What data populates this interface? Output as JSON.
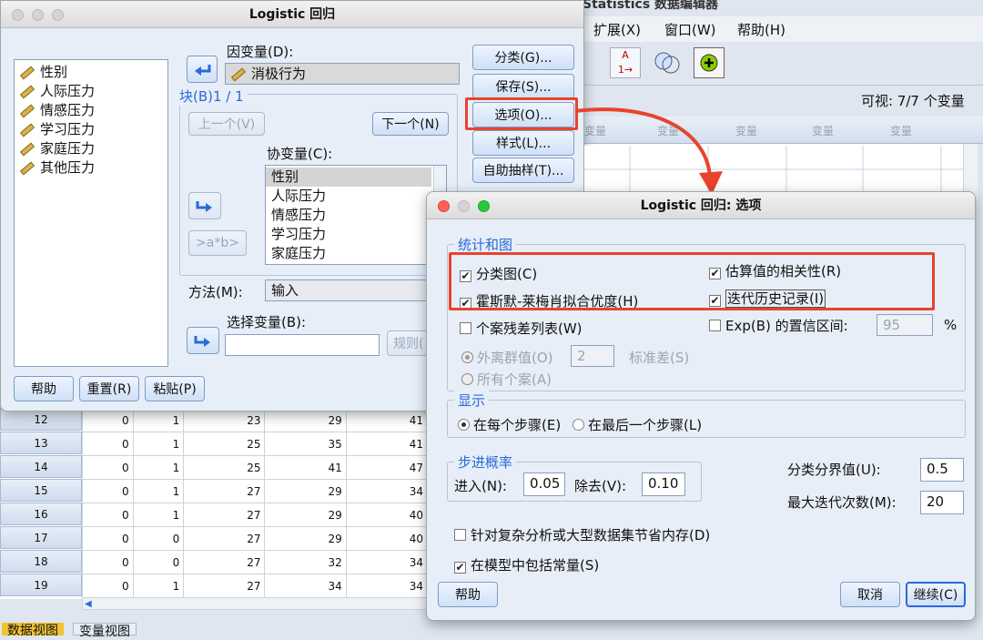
{
  "bg": {
    "title": "Statistics 数据编辑器",
    "menu": [
      "扩展(X)",
      "窗口(W)",
      "帮助(H)"
    ],
    "visible": "可视: 7/7 个变量",
    "col_header": "变量",
    "rows": [
      {
        "n": "12",
        "c": [
          "0",
          "1",
          "23",
          "29",
          "41"
        ]
      },
      {
        "n": "13",
        "c": [
          "0",
          "1",
          "25",
          "35",
          "41"
        ]
      },
      {
        "n": "14",
        "c": [
          "0",
          "1",
          "25",
          "41",
          "47"
        ]
      },
      {
        "n": "15",
        "c": [
          "0",
          "1",
          "27",
          "29",
          "34"
        ]
      },
      {
        "n": "16",
        "c": [
          "0",
          "1",
          "27",
          "29",
          "40"
        ]
      },
      {
        "n": "17",
        "c": [
          "0",
          "0",
          "27",
          "29",
          "40"
        ]
      },
      {
        "n": "18",
        "c": [
          "0",
          "0",
          "27",
          "32",
          "34"
        ]
      },
      {
        "n": "19",
        "c": [
          "0",
          "1",
          "27",
          "34",
          "34"
        ]
      }
    ],
    "tabs": [
      "数据视图",
      "变量视图"
    ]
  },
  "logistic": {
    "title": "Logistic 回归",
    "variables": [
      "性别",
      "人际压力",
      "情感压力",
      "学习压力",
      "家庭压力",
      "其他压力"
    ],
    "dependent_label": "因变量(D):",
    "dependent_value": "消极行为",
    "block_label": "块(B)1 / 1",
    "prev": "上一个(V)",
    "next": "下一个(N)",
    "covariates_label": "协变量(C):",
    "covariates": [
      "性别",
      "人际压力",
      "情感压力",
      "学习压力",
      "家庭压力"
    ],
    "interaction": ">a*b>",
    "method_label": "方法(M):",
    "method_value": "输入",
    "select_label": "选择变量(B):",
    "rule": "规则(",
    "side_buttons": [
      "分类(G)...",
      "保存(S)...",
      "选项(O)...",
      "样式(L)...",
      "自助抽样(T)..."
    ],
    "help": "帮助",
    "reset": "重置(R)",
    "paste": "粘贴(P)"
  },
  "options": {
    "title": "Logistic 回归: 选项",
    "stats_legend": "统计和图",
    "classification_plot": "分类图(C)",
    "hosmer": "霍斯默-莱梅肖拟合优度(H)",
    "correlation": "估算值的相关性(R)",
    "iteration": "迭代历史记录(I)",
    "casewise": "个案残差列表(W)",
    "ci": "Exp(B) 的置信区间:",
    "ci_value": "95",
    "pct": "%",
    "outliers": "外离群值(O)",
    "outliers_value": "2",
    "std": "标准差(S)",
    "all_cases": "所有个案(A)",
    "display_legend": "显示",
    "each_step": "在每个步骤(E)",
    "last_step": "在最后一个步骤(L)",
    "stepping_legend": "步进概率",
    "entry_label": "进入(N):",
    "entry_value": "0.05",
    "removal_label": "除去(V):",
    "removal_value": "0.10",
    "cutoff_label": "分类分界值(U):",
    "cutoff_value": "0.5",
    "maxiter_label": "最大迭代次数(M):",
    "maxiter_value": "20",
    "memory": "针对复杂分析或大型数据集节省内存(D)",
    "constant": "在模型中包括常量(S)",
    "help": "帮助",
    "cancel": "取消",
    "continue": "继续(C)",
    "check": "✔"
  },
  "colors": {
    "highlight": "#e8432d",
    "accent": "#2a6ad8"
  }
}
